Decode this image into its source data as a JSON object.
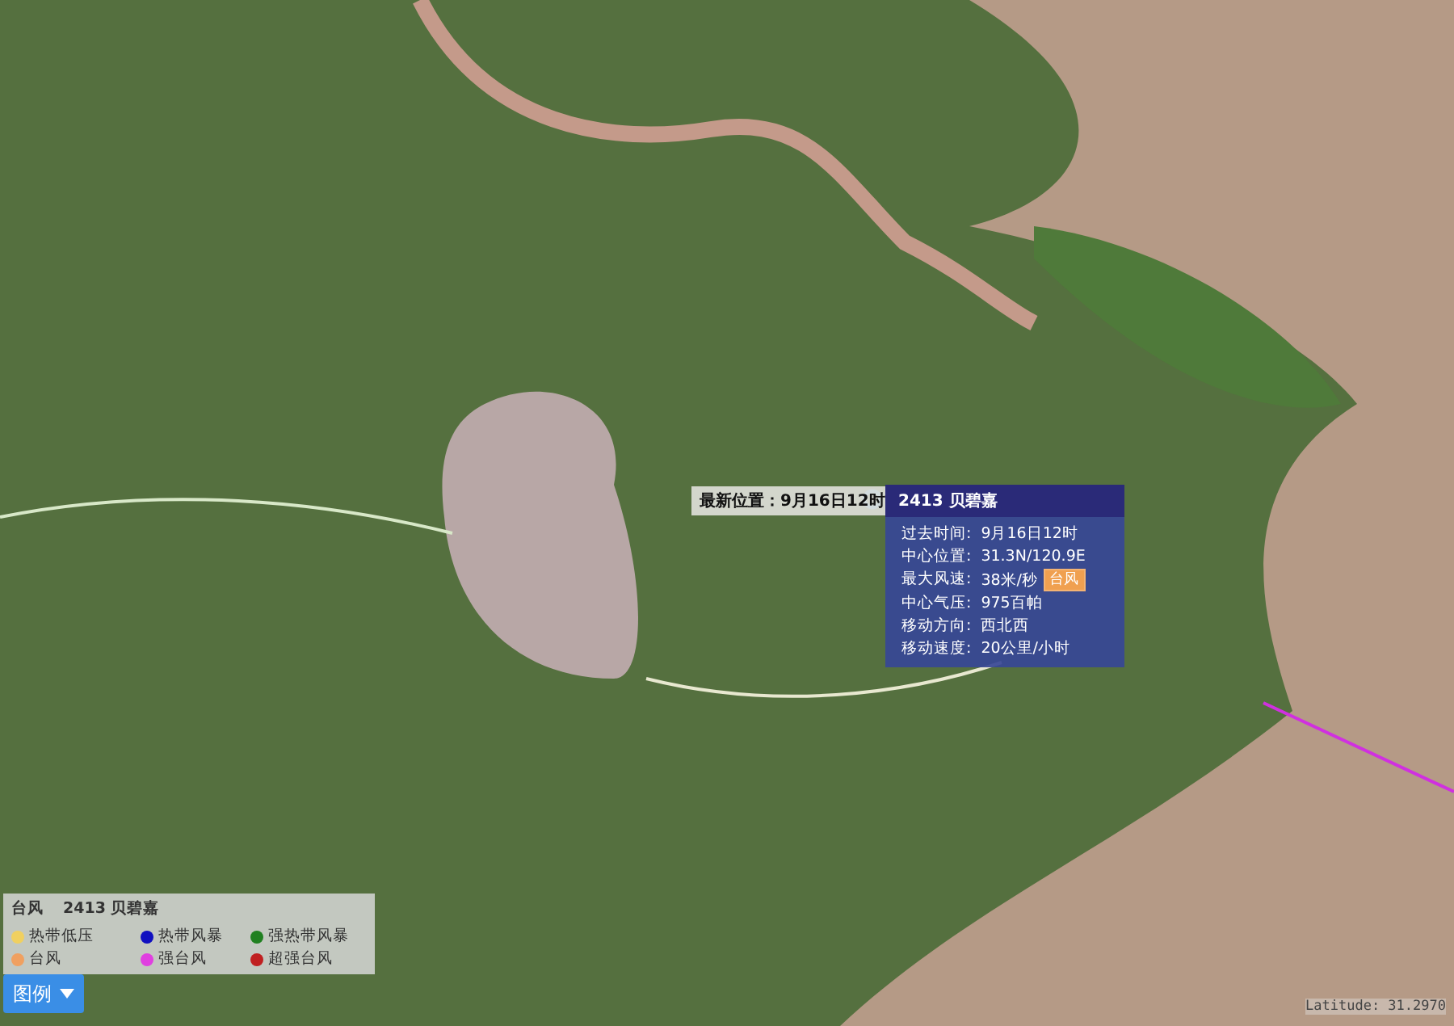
{
  "map": {
    "position_label": "最新位置：9月16日12时",
    "typhoon_popup": {
      "title": "2413 贝碧嘉",
      "rows": [
        {
          "label": "过去时间:",
          "value": "9月16日12时"
        },
        {
          "label": "中心位置:",
          "value": "31.3N/120.9E"
        },
        {
          "label": "最大风速:",
          "value": "38米/秒",
          "badge": "台风"
        },
        {
          "label": "中心气压:",
          "value": "975百帕"
        },
        {
          "label": "移动方向:",
          "value": "西北西"
        },
        {
          "label": "移动速度:",
          "value": "20公里/小时"
        }
      ]
    },
    "coordinates": "Latitude: 31.2970"
  },
  "legend": {
    "category": "台风",
    "name": "2413 贝碧嘉",
    "items": [
      {
        "label": "热带低压",
        "color": "#f0d060"
      },
      {
        "label": "热带风暴",
        "color": "#1010c0"
      },
      {
        "label": "强热带风暴",
        "color": "#208020"
      },
      {
        "label": "台风",
        "color": "#f0a060"
      },
      {
        "label": "强台风",
        "color": "#e040e0"
      },
      {
        "label": "超强台风",
        "color": "#c02020"
      }
    ],
    "button": "图例"
  }
}
